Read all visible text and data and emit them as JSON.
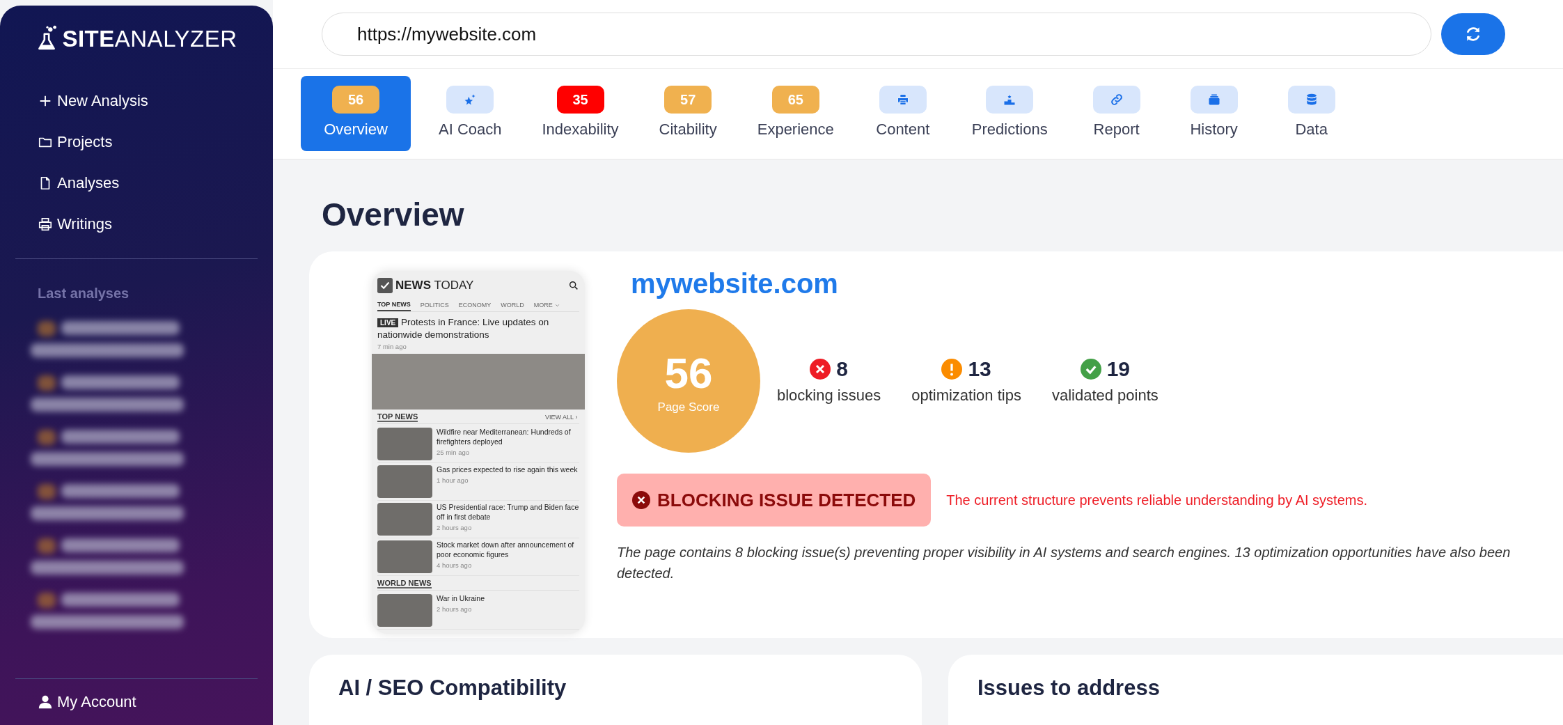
{
  "sidebar": {
    "logo_bold": "SITE",
    "logo_light": "ANALYZER",
    "nav": [
      {
        "label": "New Analysis"
      },
      {
        "label": "Projects"
      },
      {
        "label": "Analyses"
      },
      {
        "label": "Writings"
      }
    ],
    "section_title": "Last analyses",
    "recent_analyses": [
      {
        "kind": "blurred"
      },
      {
        "kind": "blurred"
      },
      {
        "kind": "blurred"
      },
      {
        "kind": "blurred"
      },
      {
        "kind": "blurred"
      },
      {
        "kind": "blurred"
      }
    ],
    "account": "My Account"
  },
  "url_bar": {
    "value": "https://mywebsite.com"
  },
  "tabs": [
    {
      "label": "Overview",
      "badge": "56",
      "color": "#f0b14f",
      "selected": true
    },
    {
      "label": "AI Coach",
      "selected": false
    },
    {
      "label": "Indexability",
      "badge": "35",
      "color": "#ff0000",
      "selected": false
    },
    {
      "label": "Citability",
      "badge": "57",
      "color": "#f0b14f",
      "selected": false
    },
    {
      "label": "Experience",
      "badge": "65",
      "color": "#f0b14f",
      "selected": false
    },
    {
      "label": "Content",
      "selected": false
    },
    {
      "label": "Predictions",
      "selected": false
    },
    {
      "label": "Report",
      "selected": false
    },
    {
      "label": "History",
      "selected": false
    },
    {
      "label": "Data",
      "selected": false
    }
  ],
  "page_title": "Overview",
  "overview": {
    "domain": "mywebsite.com",
    "score": "56",
    "score_label": "Page Score",
    "stats": [
      {
        "kind": "error",
        "value": "8",
        "label": "blocking issues"
      },
      {
        "kind": "warning",
        "value": "13",
        "label": "optimization tips"
      },
      {
        "kind": "success",
        "value": "19",
        "label": "validated points"
      }
    ],
    "alert": {
      "title": "BLOCKING ISSUE DETECTED",
      "message": "The current structure prevents reliable understanding by AI systems."
    },
    "summary": "The page contains 8 blocking issue(s) preventing proper visibility in AI systems and search engines. 13 optimization opportunities have also been detected.",
    "preview": {
      "brand_bold": "NEWS",
      "brand_light": "TODAY",
      "categories": [
        {
          "label": "TOP NEWS",
          "selected": true
        },
        {
          "label": "POLITICS",
          "selected": false
        },
        {
          "label": "ECONOMY",
          "selected": false
        },
        {
          "label": "WORLD",
          "selected": false
        },
        {
          "label": "MORE",
          "selected": false
        }
      ],
      "live_badge": "LIVE",
      "headline": "Protests in France: Live updates on nationwide demonstrations",
      "headline_time": "7 min ago",
      "section": "TOP NEWS",
      "view_all": "VIEW ALL",
      "stories": [
        {
          "title": "Wildfire near Mediterranean: Hundreds of firefighters deployed",
          "time": "25 min ago"
        },
        {
          "title": "Gas prices expected to rise again this week",
          "time": "1 hour ago"
        },
        {
          "title": "US Presidential race: Trump and Biden face off in first debate",
          "time": "2 hours ago"
        },
        {
          "title": "Stock market down after announcement of poor economic figures",
          "time": "4 hours ago"
        }
      ],
      "section_2": "WORLD NEWS",
      "stories_2": [
        {
          "title": "War in Ukraine",
          "time": "2 hours ago"
        }
      ]
    }
  },
  "panels": [
    {
      "title": "AI / SEO Compatibility"
    },
    {
      "title": "Issues to address"
    }
  ]
}
